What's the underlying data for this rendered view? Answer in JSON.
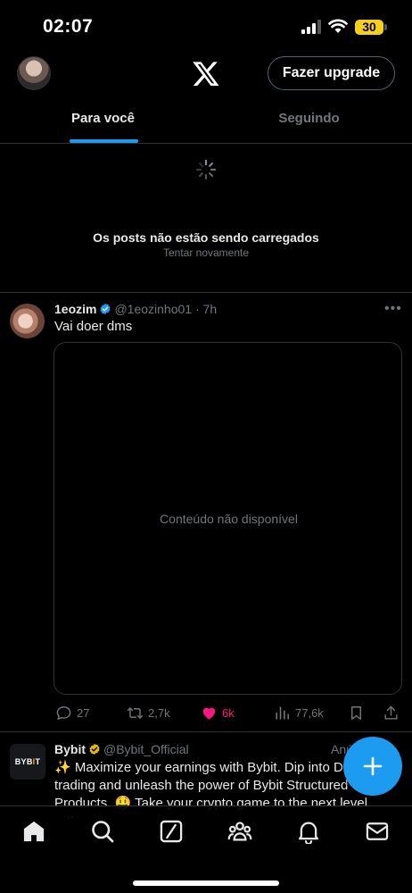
{
  "status_bar": {
    "time": "02:07",
    "battery": "30",
    "battery_color": "#f5cf1b"
  },
  "header": {
    "logo": "x-logo-icon",
    "upgrade_label": "Fazer upgrade"
  },
  "tabs": [
    {
      "label": "Para você",
      "active": true
    },
    {
      "label": "Seguindo",
      "active": false
    }
  ],
  "notice": {
    "title": "Os posts não estão sendo carregados",
    "retry": "Tentar novamente"
  },
  "post1": {
    "name": "1eozim",
    "handle": "@1eozinho01",
    "separator": "·",
    "time": "7h",
    "text": "Vai doer dms",
    "media_text": "Conteúdo não disponível",
    "stats": {
      "replies": "27",
      "reposts": "2,7k",
      "likes": "6k",
      "views": "77,6k"
    },
    "liked": true
  },
  "post2": {
    "name": "Bybit",
    "handle": "@Bybit_Official",
    "ad_label": "Anú",
    "avatar_text": "BYB",
    "avatar_accent": "I",
    "avatar_text_end": "T",
    "text": "✨ Maximize your earnings with Bybit. Dip into Dec trading and unleash the power of Bybit Structured Products. 🤑 Take your crypto game to the next level with"
  },
  "bottom_nav": [
    "home-icon",
    "search-icon",
    "grok-icon",
    "communities-icon",
    "notifications-icon",
    "messages-icon"
  ],
  "colors": {
    "accent": "#1d9bf0",
    "like": "#f91880",
    "muted": "#71767b",
    "border": "#2f3336"
  }
}
